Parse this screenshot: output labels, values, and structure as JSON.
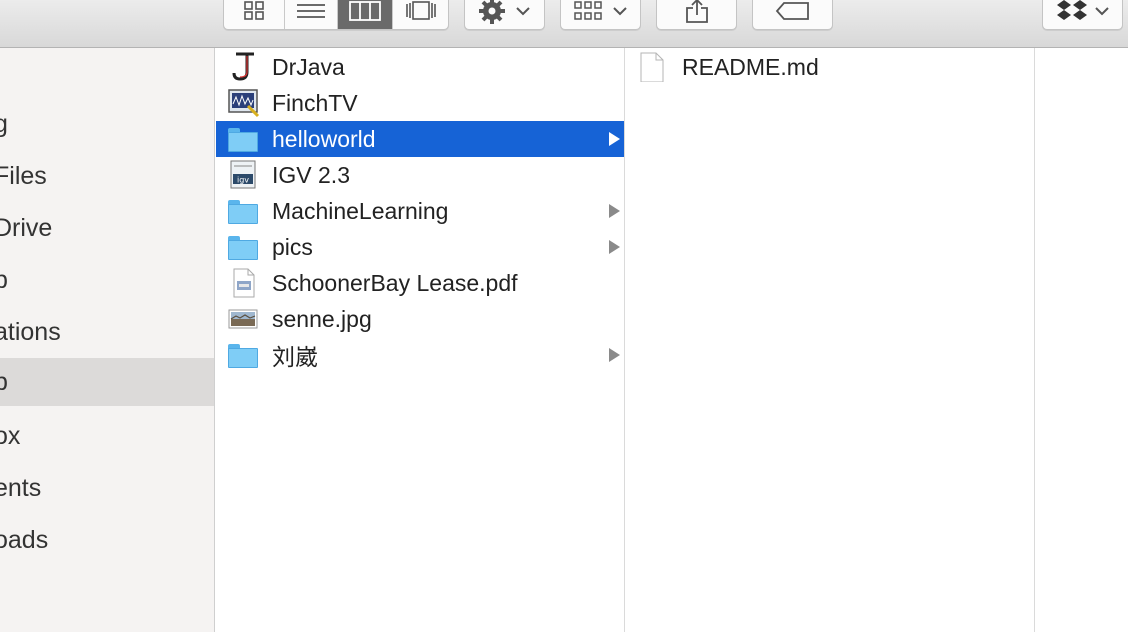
{
  "toolbar": {
    "view_buttons": [
      "icon-view-icon",
      "list-view-icon",
      "column-view-icon",
      "cover-flow-icon"
    ],
    "active_view": "column-view-icon",
    "action_button_icon": "gear-icon",
    "arrange_button_icon": "arrange-grid-icon",
    "share_button_icon": "share-icon",
    "tag_button_icon": "tag-icon",
    "dropbox_button_icon": "dropbox-icon"
  },
  "sidebar": {
    "items": [
      {
        "label": "g"
      },
      {
        "label": "Files"
      },
      {
        "label": "Drive"
      },
      {
        "label": "p"
      },
      {
        "label": "ations"
      },
      {
        "label": "p"
      },
      {
        "label": "ox"
      },
      {
        "label": "ents"
      },
      {
        "label": "oads"
      }
    ],
    "selected_index": 5
  },
  "column1": {
    "items": [
      {
        "name": "DrJava",
        "icon": "drjava-app-icon",
        "has_children": false
      },
      {
        "name": "FinchTV",
        "icon": "finchtv-app-icon",
        "has_children": false
      },
      {
        "name": "helloworld",
        "icon": "folder-icon",
        "has_children": true
      },
      {
        "name": "IGV 2.3",
        "icon": "igv-app-icon",
        "has_children": false
      },
      {
        "name": "MachineLearning",
        "icon": "folder-icon",
        "has_children": true
      },
      {
        "name": "pics",
        "icon": "folder-icon",
        "has_children": true
      },
      {
        "name": "SchoonerBay Lease.pdf",
        "icon": "pdf-file-icon",
        "has_children": false
      },
      {
        "name": "senne.jpg",
        "icon": "image-file-icon",
        "has_children": false
      },
      {
        "name": "刘崴",
        "icon": "folder-icon",
        "has_children": true
      }
    ],
    "selected_index": 2
  },
  "column2": {
    "items": [
      {
        "name": "README.md",
        "icon": "document-file-icon"
      }
    ]
  },
  "colors": {
    "selection": "#1663d6",
    "folder": "#7fcdf6",
    "sidebar_bg": "#f5f3f2"
  }
}
